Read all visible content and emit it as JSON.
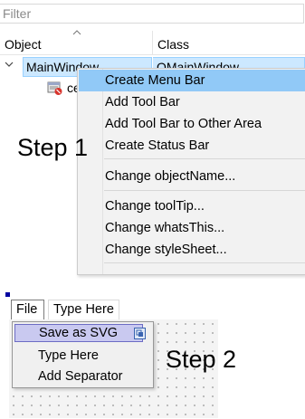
{
  "filter": {
    "placeholder": "Filter"
  },
  "inspector": {
    "columns": [
      "Object",
      "Class"
    ],
    "rows": [
      {
        "name": "MainWindow",
        "class": "QMainWindow"
      },
      {
        "name": "ce"
      }
    ]
  },
  "context_menu": {
    "items": [
      "Create Menu Bar",
      "Add Tool Bar",
      "Add Tool Bar to Other Area",
      "Create Status Bar",
      "Change objectName...",
      "Change toolTip...",
      "Change whatsThis...",
      "Change styleSheet..."
    ],
    "highlighted": "Create Menu Bar"
  },
  "step1_label": "Step 1",
  "menubar": {
    "items": [
      "File",
      "Type Here"
    ]
  },
  "dropdown": {
    "items": [
      "Save as SVG",
      "Type Here",
      "Add Separator"
    ],
    "highlighted": "Save as SVG"
  },
  "step2_label": "Step 2",
  "colors": {
    "selection_row": "#cce8ff",
    "menu_highlight": "#91c9f7",
    "dropdown_highlight": "#c9c9f0",
    "handle": "#0000a0"
  },
  "icons": [
    "chevron-down-icon",
    "sort-arrow-icon",
    "widget-icon",
    "action-badge-icon"
  ]
}
